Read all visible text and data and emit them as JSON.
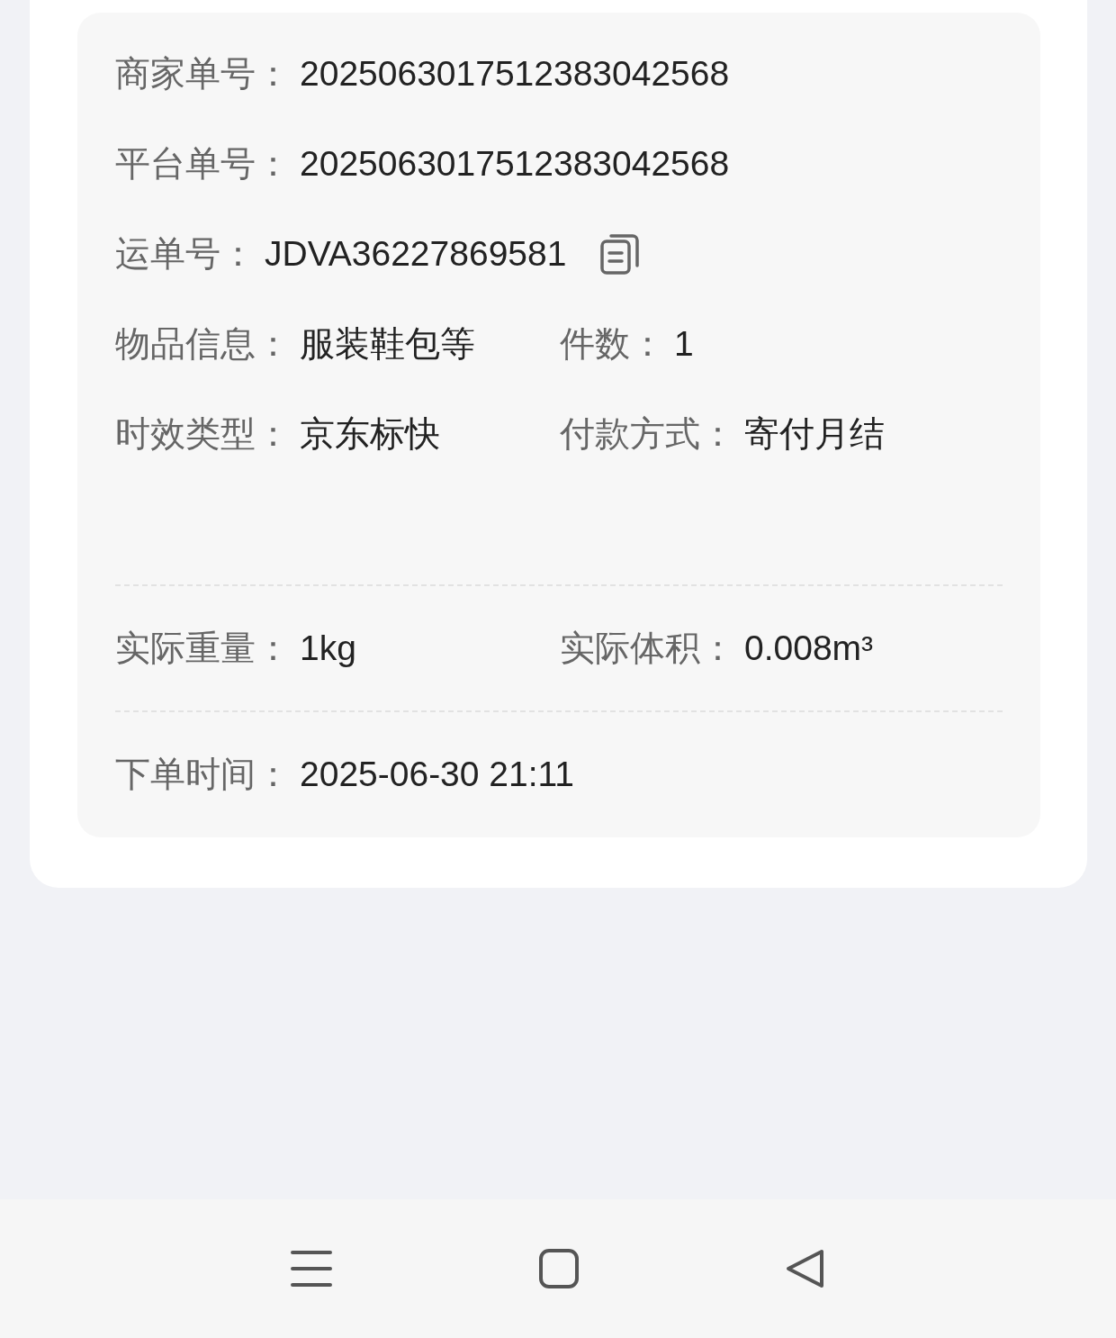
{
  "order_details": {
    "sections": [
      {
        "rows": [
          {
            "fields": [
              {
                "label": "商家单号：",
                "value": "2025063017512383042568"
              }
            ]
          },
          {
            "fields": [
              {
                "label": "平台单号：",
                "value": "2025063017512383042568"
              }
            ]
          },
          {
            "fields": [
              {
                "label": "运单号：",
                "value": "JDVA36227869581",
                "copy_icon": true
              }
            ]
          },
          {
            "fields": [
              {
                "label": "物品信息：",
                "value": "服装鞋包等"
              },
              {
                "label": "件数：",
                "value": "1"
              }
            ]
          },
          {
            "fields": [
              {
                "label": "时效类型：",
                "value": "京东标快"
              },
              {
                "label": "付款方式：",
                "value": "寄付月结"
              }
            ]
          }
        ]
      },
      {
        "rows": [
          {
            "fields": [
              {
                "label": "实际重量：",
                "value": "1kg"
              },
              {
                "label": "实际体积：",
                "value": "0.008m³"
              }
            ]
          }
        ]
      },
      {
        "rows": [
          {
            "fields": [
              {
                "label": "下单时间：",
                "value": "2025-06-30 21:11"
              }
            ]
          }
        ]
      }
    ]
  },
  "nav_bar": {
    "buttons": [
      {
        "kind": "menu"
      },
      {
        "kind": "home"
      },
      {
        "kind": "back"
      }
    ]
  }
}
